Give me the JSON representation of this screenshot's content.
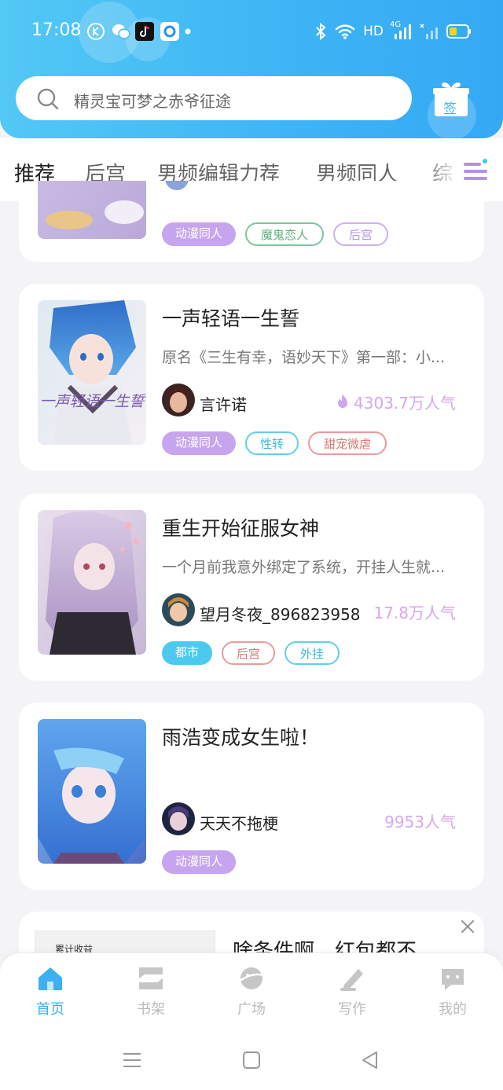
{
  "status_bar": {
    "time": "17:08",
    "network_label": "HD",
    "network_gen": "4G"
  },
  "search": {
    "placeholder": "精灵宝可梦之赤爷征途"
  },
  "checkin": {
    "label": "签"
  },
  "tabs": [
    {
      "label": "推荐",
      "active": true
    },
    {
      "label": "后宫"
    },
    {
      "label": "男频编辑力荐"
    },
    {
      "label": "男频同人"
    },
    {
      "label": "综"
    }
  ],
  "books": [
    {
      "tags": [
        {
          "label": "动漫同人",
          "style": "fill-purple"
        },
        {
          "label": "魔鬼恋人",
          "style": "out-green"
        },
        {
          "label": "后宫",
          "style": "out-purple"
        }
      ]
    },
    {
      "title": "一声轻语一生誓",
      "desc": "原名《三生有幸，语妙天下》第一部：小...",
      "author": "言许诺",
      "popularity": "4303.7万人气",
      "hot": true,
      "cover_text": "一声轻语一生誓",
      "tags": [
        {
          "label": "动漫同人",
          "style": "fill-purple"
        },
        {
          "label": "性转",
          "style": "out-cyan"
        },
        {
          "label": "甜宠微虐",
          "style": "out-red"
        }
      ]
    },
    {
      "title": "重生开始征服女神",
      "desc": "一个月前我意外绑定了系统，开挂人生就...",
      "author": "望月冬夜_896823958",
      "popularity": "17.8万人气",
      "tags": [
        {
          "label": "都市",
          "style": "fill-blue"
        },
        {
          "label": "后宫",
          "style": "out-red"
        },
        {
          "label": "外挂",
          "style": "out-cyan"
        }
      ]
    },
    {
      "title": "雨浩变成女生啦！",
      "desc": "",
      "author": "天天不拖梗",
      "popularity": "9953人气",
      "tags": [
        {
          "label": "动漫同人",
          "style": "fill-purple"
        }
      ]
    }
  ],
  "ad": {
    "thumb_label": "累计收益",
    "text": "啥条件啊，红包都不"
  },
  "bottom_nav": [
    {
      "label": "首页",
      "icon": "home-icon",
      "active": true
    },
    {
      "label": "书架",
      "icon": "bookshelf-icon"
    },
    {
      "label": "广场",
      "icon": "planet-icon"
    },
    {
      "label": "写作",
      "icon": "pen-icon"
    },
    {
      "label": "我的",
      "icon": "chat-bubble-icon"
    }
  ],
  "colors": {
    "header_start": "#53c8f5",
    "header_end": "#35a8f4",
    "accent_purple": "#c7a5ee",
    "nav_active": "#3cb0f2",
    "popularity": "#d6a6ec"
  }
}
